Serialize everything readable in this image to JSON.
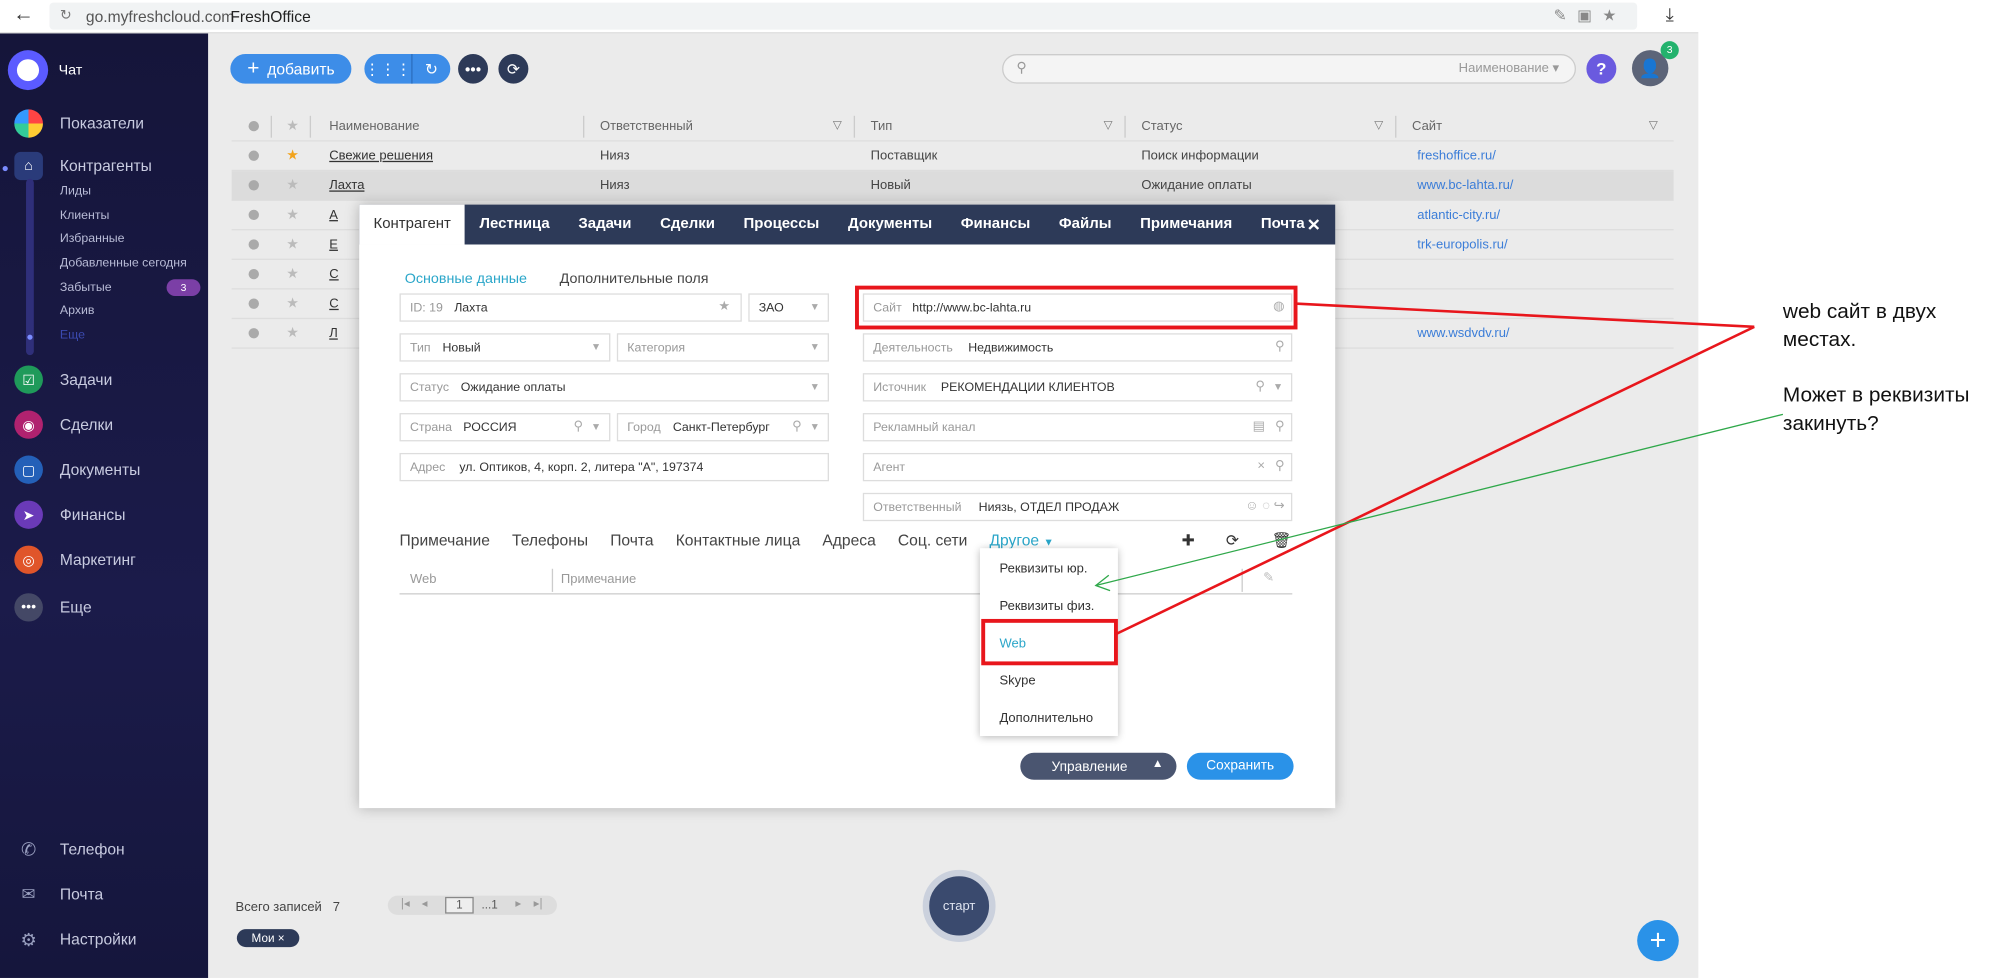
{
  "browser": {
    "url": "go.myfreshcloud.com",
    "title": "FreshOffice"
  },
  "sidebar": {
    "chat": "Чат",
    "items": [
      {
        "label": "Показатели"
      },
      {
        "label": "Контрагенты"
      },
      {
        "label": "Задачи"
      },
      {
        "label": "Сделки"
      },
      {
        "label": "Документы"
      },
      {
        "label": "Финансы"
      },
      {
        "label": "Маркетинг"
      },
      {
        "label": "Еще"
      }
    ],
    "subitems": [
      "Лиды",
      "Клиенты",
      "Избранные",
      "Добавленные сегодня",
      "Забытые",
      "Архив",
      "Еще"
    ],
    "forgotten_badge": "3",
    "bottom": [
      "Телефон",
      "Почта",
      "Настройки"
    ]
  },
  "toolbar": {
    "add_label": "добавить",
    "search_placeholder": "Наименование",
    "help": "?",
    "notifications": "3"
  },
  "table": {
    "headers": [
      "Наименование",
      "Ответственный",
      "Тип",
      "Статус",
      "Сайт"
    ],
    "rows": [
      {
        "name": "Свежие решения",
        "resp": "Нияз",
        "type": "Поставщик",
        "status": "Поиск информации",
        "site": "freshoffice.ru/",
        "fav": true
      },
      {
        "name": "Лахта",
        "resp": "Нияз",
        "type": "Новый",
        "status": "Ожидание оплаты",
        "site": "www.bc-lahta.ru/",
        "fav": false
      },
      {
        "name": "А",
        "resp": "",
        "type": "",
        "status": "",
        "site": "atlantic-city.ru/",
        "fav": false
      },
      {
        "name": "Е",
        "resp": "",
        "type": "",
        "status": "",
        "site": "trk-europolis.ru/",
        "fav": false
      },
      {
        "name": "С",
        "resp": "",
        "type": "",
        "status": "",
        "site": "",
        "fav": false
      },
      {
        "name": "С",
        "resp": "",
        "type": "",
        "status": "",
        "site": "",
        "fav": false
      },
      {
        "name": "Л",
        "resp": "",
        "type": "",
        "status": "",
        "site": "www.wsdvdv.ru/",
        "fav": false
      }
    ]
  },
  "footer": {
    "total_label": "Всего записей",
    "total": "7",
    "page": "1",
    "pages": "...1",
    "chip": "Мои",
    "start": "старт"
  },
  "modal": {
    "tabs": [
      "Контрагент",
      "Лестница",
      "Задачи",
      "Сделки",
      "Процессы",
      "Документы",
      "Финансы",
      "Файлы",
      "Примечания",
      "Почта"
    ],
    "subtabs": {
      "main": "Основные данные",
      "extra": "Дополнительные поля"
    },
    "fields": {
      "id_label": "ID: 19",
      "name": "Лахта",
      "form": "ЗАО",
      "type_label": "Тип",
      "type": "Новый",
      "category_label": "Категория",
      "status_label": "Статус",
      "status": "Ожидание оплаты",
      "country_label": "Страна",
      "country": "РОССИЯ",
      "city_label": "Город",
      "city": "Санкт-Петербург",
      "address_label": "Адрес",
      "address": "ул. Оптиков, 4, корп. 2, литера \"А\", 197374",
      "site_label": "Сайт",
      "site": "http://www.bc-lahta.ru",
      "activity_label": "Деятельность",
      "activity": "Недвижимость",
      "source_label": "Источник",
      "source": "РЕКОМЕНДАЦИИ КЛИЕНТОВ",
      "adchannel_label": "Рекламный канал",
      "agent_label": "Агент",
      "resp_label": "Ответственный",
      "resp": "Ниязь, ОТДЕЛ ПРОДАЖ"
    },
    "lower_tabs": [
      "Примечание",
      "Телефоны",
      "Почта",
      "Контактные лица",
      "Адреса",
      "Соц. сети"
    ],
    "other_tab": "Другое",
    "grid_headers": [
      "Web",
      "Примечание"
    ],
    "dropdown": [
      "Реквизиты юр.",
      "Реквизиты физ.",
      "Web",
      "Skype",
      "Дополнительно"
    ],
    "manage": "Управление",
    "save": "Сохранить"
  },
  "annotation": {
    "line1": "web сайт в двух",
    "line2": "местах.",
    "line3": "Может в реквизиты",
    "line4": "закинуть?"
  },
  "colors": {
    "accent": "#3d8de8",
    "sidebar": "#1b1b4a",
    "header": "#2d3a58",
    "highlight": "#e8161c",
    "link": "#2aa6c9"
  }
}
